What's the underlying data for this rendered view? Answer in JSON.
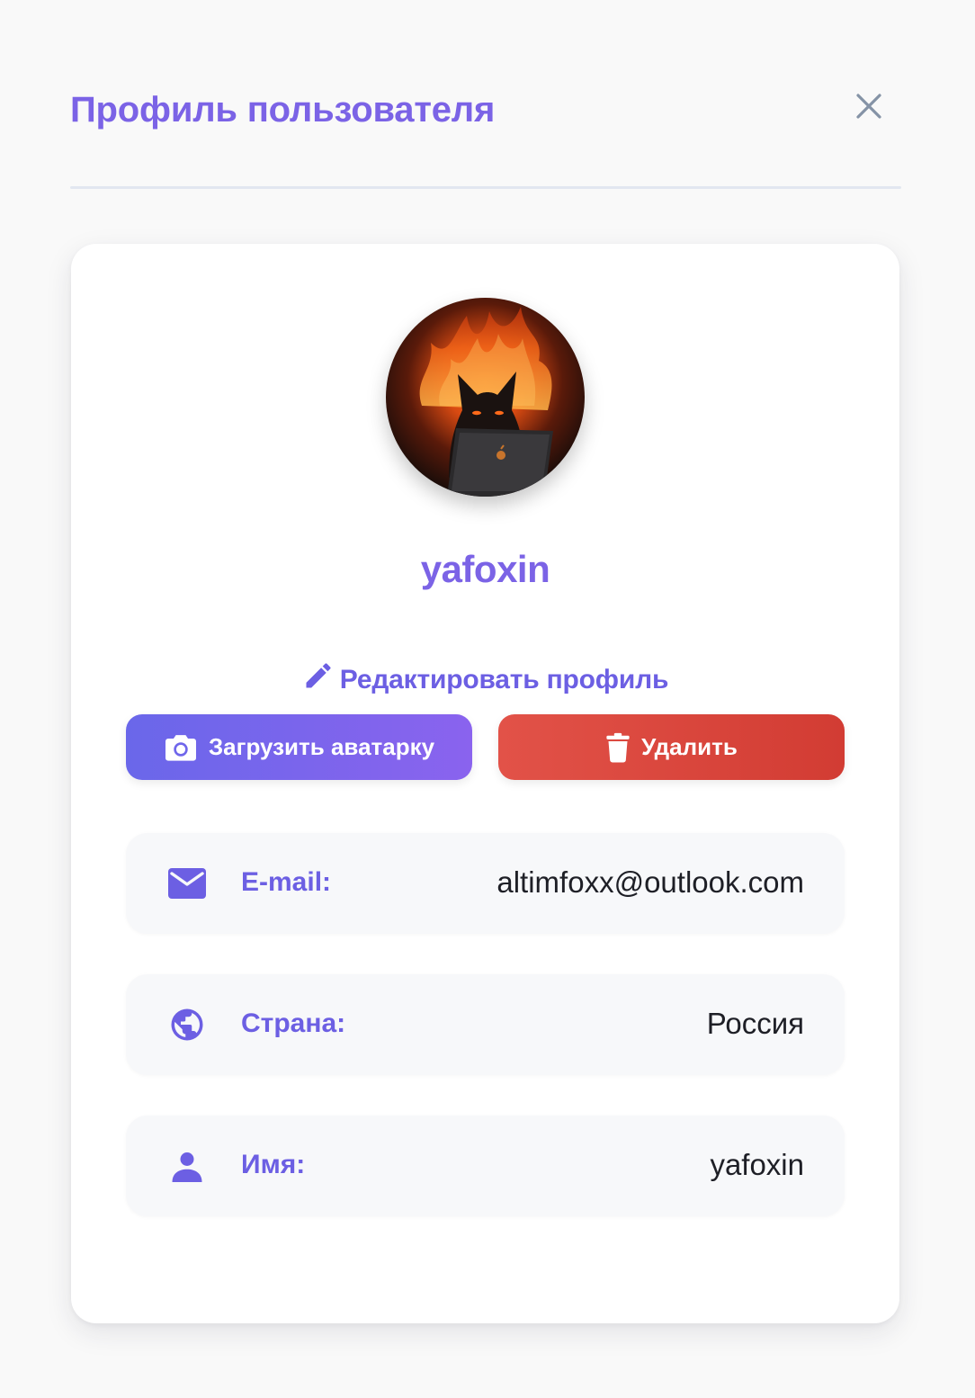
{
  "header": {
    "title": "Профиль пользователя",
    "close_icon": "close-icon"
  },
  "profile": {
    "username": "yafoxin",
    "avatar": "fox-with-flames-laptop-avatar"
  },
  "actions": {
    "edit_label": "Редактировать профиль",
    "edit_icon": "pencil-icon",
    "upload_label": "Загрузить аватарку",
    "upload_icon": "camera-icon",
    "delete_label": "Удалить",
    "delete_icon": "trash-icon"
  },
  "fields": [
    {
      "icon": "mail-icon",
      "label": "E-mail:",
      "value": "altimfoxx@outlook.com"
    },
    {
      "icon": "globe-icon",
      "label": "Страна:",
      "value": "Россия"
    },
    {
      "icon": "user-icon",
      "label": "Имя:",
      "value": "yafoxin"
    }
  ],
  "colors": {
    "accent": "#7b63e6",
    "upload_gradient_start": "#6a67ea",
    "upload_gradient_end": "#8a63ee",
    "danger": "#d94840",
    "background": "#f9f9f9",
    "card": "#ffffff",
    "row": "#f7f8fa"
  }
}
